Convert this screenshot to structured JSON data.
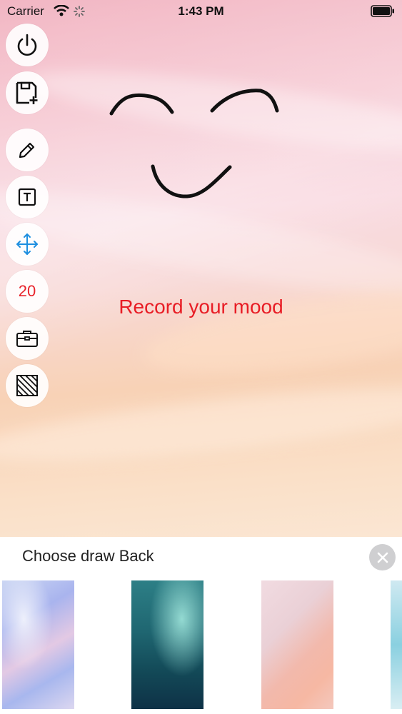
{
  "status_bar": {
    "carrier": "Carrier",
    "time": "1:43 PM"
  },
  "toolbar": {
    "items": [
      {
        "name": "power",
        "icon": "power-icon"
      },
      {
        "name": "save",
        "icon": "save-add-icon"
      },
      {
        "name": "pencil",
        "icon": "pencil-icon"
      },
      {
        "name": "text",
        "icon": "text-icon"
      },
      {
        "name": "move",
        "icon": "move-arrows-icon"
      },
      {
        "name": "size",
        "label": "20"
      },
      {
        "name": "toolbox",
        "icon": "toolbox-icon"
      },
      {
        "name": "pattern",
        "icon": "hatch-pattern-icon"
      }
    ]
  },
  "canvas": {
    "caption": "Record your mood"
  },
  "sheet": {
    "title": "Choose draw Back",
    "backgrounds": [
      "lavender-marble",
      "teal-aurora",
      "pink-peach",
      "light-blue"
    ]
  },
  "colors": {
    "accent_red": "#e81d25",
    "move_blue": "#1e8fe0",
    "sheet_bg": "#ffffff"
  }
}
